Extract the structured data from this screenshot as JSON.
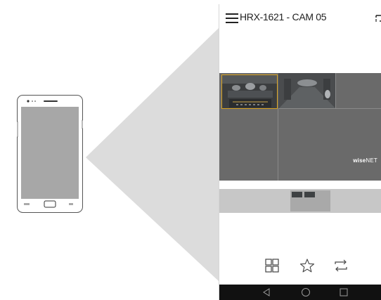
{
  "app": {
    "title": "HRX-1621 - CAM 05",
    "brand_logo": "wisenet"
  },
  "icons": {
    "menu": "hamburger-menu-icon",
    "corner": "cast-icon",
    "layout": "grid-layout-icon",
    "favorite": "star-icon",
    "switch": "swap-arrows-icon",
    "back": "triangle-back-icon",
    "home": "circle-home-icon",
    "recents": "square-recents-icon"
  },
  "colors": {
    "selected_tile_border": "#d9a321",
    "video_background": "#6a6a6a",
    "nav_bar": "#111111",
    "projection": "#dcdcdc"
  }
}
